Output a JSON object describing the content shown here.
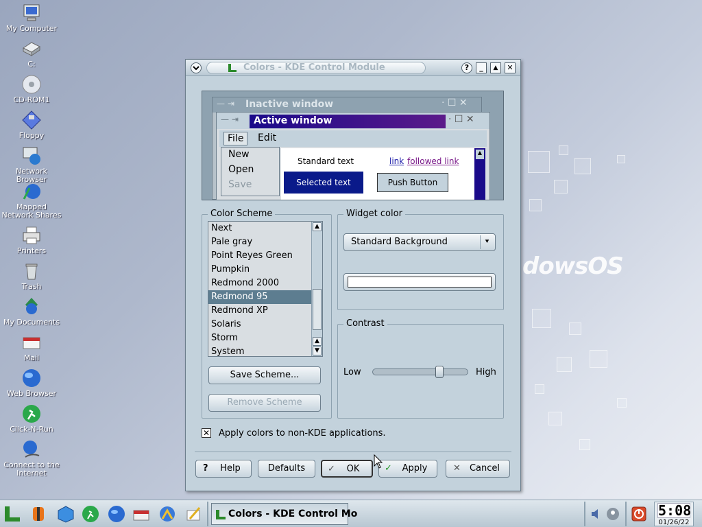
{
  "desktop_icons": [
    {
      "label": "My Computer",
      "icon": "computer-icon"
    },
    {
      "label": "C:",
      "icon": "drive-icon"
    },
    {
      "label": "CD-ROM1",
      "icon": "cdrom-icon"
    },
    {
      "label": "Floppy",
      "icon": "floppy-icon"
    },
    {
      "label": "Network Browser",
      "icon": "network-icon"
    },
    {
      "label": "Mapped Network Shares",
      "icon": "network-shares-icon"
    },
    {
      "label": "Printers",
      "icon": "printer-icon"
    },
    {
      "label": "Trash",
      "icon": "trash-icon"
    },
    {
      "label": "My Documents",
      "icon": "documents-icon"
    },
    {
      "label": "Mail",
      "icon": "mail-icon"
    },
    {
      "label": "Web Browser",
      "icon": "globe-icon"
    },
    {
      "label": "Click-N-Run",
      "icon": "runner-icon"
    },
    {
      "label": "Connect to the Internet",
      "icon": "connect-icon"
    }
  ],
  "desktop_brand": "dowsOS",
  "window": {
    "title": "Colors - KDE Control Module",
    "controls": {
      "help": "?",
      "minimize": "_",
      "maximize": "▲",
      "close": "✕"
    }
  },
  "preview": {
    "inactive_title": "Inactive window",
    "active_title": "Active window",
    "menu": [
      "File",
      "Edit"
    ],
    "dropdown_items": [
      {
        "label": "New",
        "disabled": false
      },
      {
        "label": "Open",
        "disabled": false
      },
      {
        "label": "Save",
        "disabled": true
      }
    ],
    "standard_text": "Standard text",
    "link": "link",
    "followed_link": "followed link",
    "selected_text": "Selected text",
    "push_button": "Push Button"
  },
  "color_scheme": {
    "title": "Color Scheme",
    "items": [
      "Next",
      "Pale gray",
      "Point Reyes Green",
      "Pumpkin",
      "Redmond 2000",
      "Redmond 95",
      "Redmond XP",
      "Solaris",
      "Storm",
      "System"
    ],
    "selected": "Redmond 95",
    "save_button": "Save Scheme...",
    "remove_button": "Remove Scheme"
  },
  "widget_color": {
    "title": "Widget color",
    "selected": "Standard Background",
    "swatch": "#ffffff"
  },
  "contrast": {
    "title": "Contrast",
    "low": "Low",
    "high": "High",
    "value": 0.72
  },
  "apply_non_kde": {
    "label": "Apply colors to non-KDE applications.",
    "checked": true
  },
  "buttons": {
    "help": "Help",
    "defaults": "Defaults",
    "ok": "OK",
    "apply": "Apply",
    "cancel": "Cancel"
  },
  "taskbar": {
    "task_label": "Colors - KDE Control Mo",
    "clock_time": "5:08",
    "clock_date": "01/26/22"
  },
  "colors": {
    "active_title": "#1a0a8a",
    "selection": "#0a1a8a",
    "window_bg": "#c3d2dc"
  }
}
